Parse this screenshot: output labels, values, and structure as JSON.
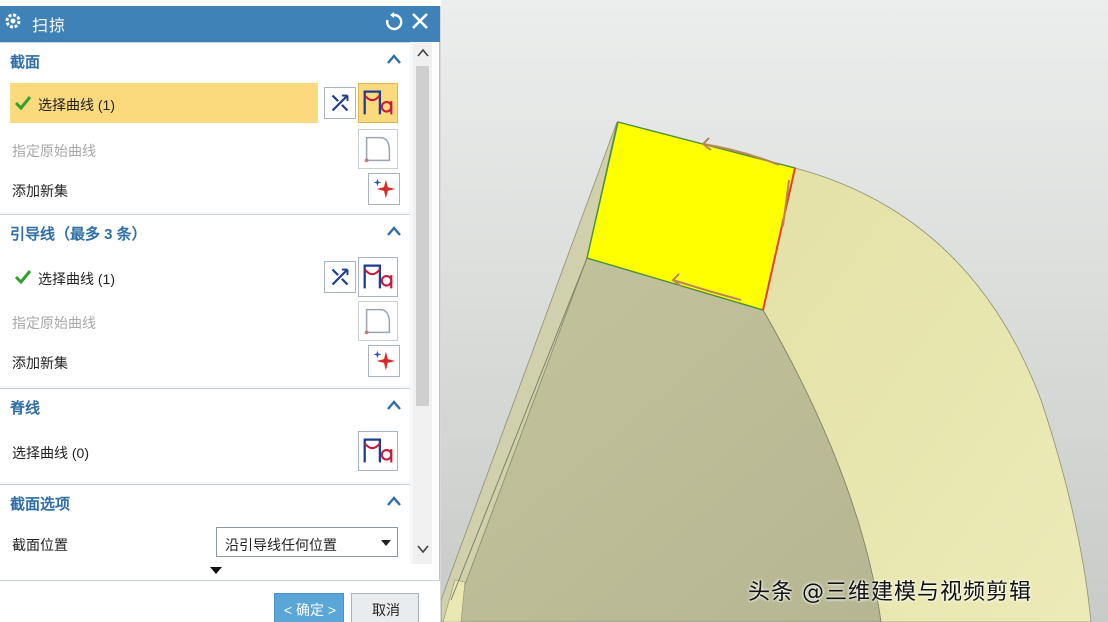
{
  "dialog": {
    "title": "扫掠",
    "icons": {
      "gear": "gear-icon",
      "reset": "reset-icon",
      "close": "close-icon"
    }
  },
  "section": {
    "title": "截面",
    "select_curve": "选择曲线 (1)",
    "specify_origin": "指定原始曲线",
    "add_new_set": "添加新集"
  },
  "guide": {
    "title": "引导线（最多 3 条）",
    "select_curve": "选择曲线 (1)",
    "specify_origin": "指定原始曲线",
    "add_new_set": "添加新集"
  },
  "spine": {
    "title": "脊线",
    "select_curve": "选择曲线 (0)"
  },
  "section_options": {
    "title": "截面选项",
    "position_label": "截面位置",
    "position_value": "沿引导线任何位置"
  },
  "footer": {
    "ok": "< 确定 >",
    "cancel": "取消"
  },
  "watermark": "头条 @三维建模与视频剪辑",
  "colors": {
    "title_bar": "#3f82b8",
    "group_title": "#2f6fa5",
    "highlight": "#fbd97d",
    "ok_button": "#5aa6d8",
    "selected_face": "#ffff00",
    "body_surface": "#e8e6a4"
  }
}
